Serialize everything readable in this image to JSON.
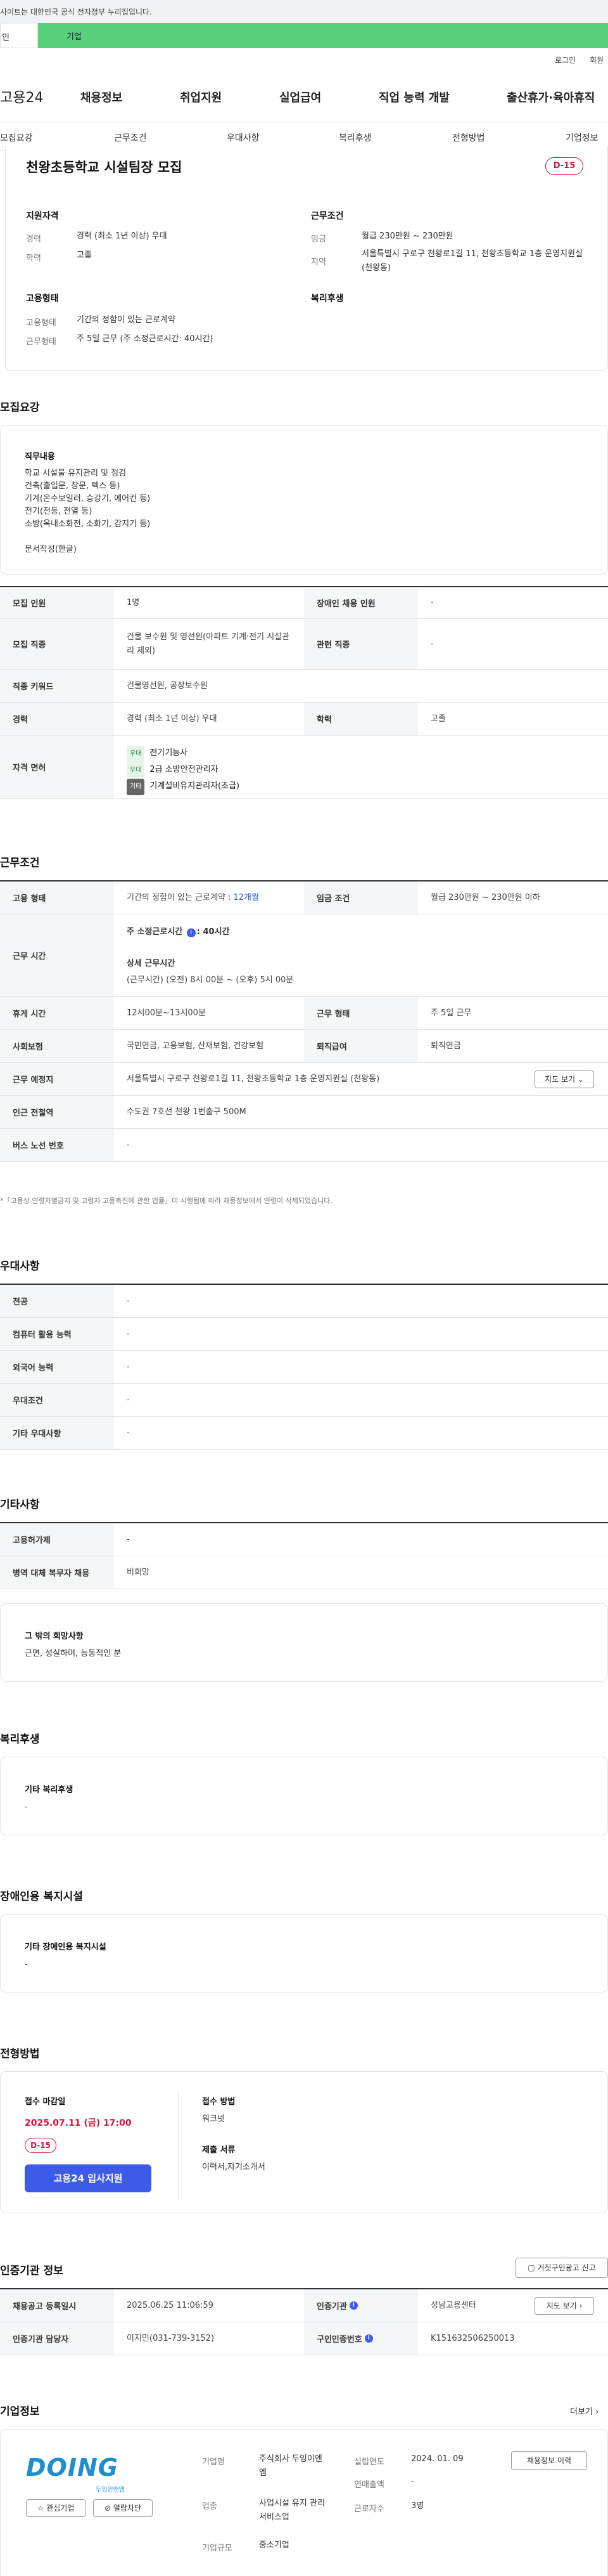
{
  "topbar": {
    "text": "사이트는 대한민국 공식 전자정부 누리집입니다."
  },
  "tabs": [
    "인",
    "기업"
  ],
  "util": {
    "login": "로그인",
    "join": "회원"
  },
  "header": {
    "logo": "고용24",
    "nav": [
      "채용정보",
      "취업지원",
      "실업급여",
      "직업 능력 개발",
      "출산휴가·육아휴직"
    ]
  },
  "subnav": [
    "모집요강",
    "근무조건",
    "우대사항",
    "복리후생",
    "전형방법",
    "기업정보"
  ],
  "summary": {
    "title": "천왕초등학교 시설팀장 모집",
    "dday": "D-15",
    "qual_head": "지원자격",
    "cond_head": "근무조건",
    "career_label": "경력",
    "career": "경력 (최소 1년 이상) 우대",
    "edu_label": "학력",
    "edu": "고졸",
    "wage_label": "임금",
    "wage": "월급 230만원 ~ 230만원",
    "region_label": "지역",
    "region": "서울특별시 구로구 천왕로1길 11, 천왕초등학교 1층 운영지원실 (천왕동)",
    "emp_head": "고용형태",
    "welfare_head": "복리후생",
    "emp_label": "고용형태",
    "emp": "기간의 정함이 있는 근로계약",
    "work_label": "근무형태",
    "work": "주 5일 근무 (주 소정근로시간: 40시간)"
  },
  "recruit": {
    "heading": "모집요강",
    "duty_title": "직무내용",
    "duty": [
      "학교 시설물 유지관리 및 점검",
      "건축(출입문, 창문, 텍스 등)",
      "기계(온수보일러, 승강기, 에어컨 등)",
      "전기(전등, 전열 등)",
      "소방(옥내소화전, 소화기, 감지기 등)",
      "",
      "문서작성(한글)"
    ],
    "rows": [
      {
        "l1": "모집 인원",
        "v1": "1명",
        "l2": "장애인 채용 인원",
        "v2": "-"
      },
      {
        "l1": "모집 직종",
        "v1": "건물 보수원 및 영선원(아파트 기계·전기 시설관리 제외)",
        "l2": "관련 직종",
        "v2": "-"
      },
      {
        "l1": "직종 키워드",
        "v1": "건물영선원, 공장보수원"
      },
      {
        "l1": "경력",
        "v1": "경력 (최소 1년 이상) 우대",
        "l2": "학력",
        "v2": "고졸"
      }
    ],
    "license_label": "자격 면허",
    "licenses": [
      {
        "badge": "우대",
        "name": "전기기능사"
      },
      {
        "badge": "우대",
        "name": "2급 소방안전관리자"
      },
      {
        "badge": "기타",
        "name": "기계설비유지관리자(초급)"
      }
    ],
    "colors": {
      "pref_bg": "#e6f4ea",
      "pref_fg": "#2d8a49",
      "etc_bg": "#666666",
      "etc_fg": "#ffffff"
    }
  },
  "conditions": {
    "heading": "근무조건",
    "emp_label": "고용 형태",
    "emp": "기간의 정함이 있는 근로계약 : ",
    "emp_period": "12개월",
    "wage_label": "임금 조건",
    "wage": "월급 230만원 ~ 230만원 이하",
    "hours_label": "근무 시간",
    "hours_week": "주 소정근로시간 ",
    "hours_week_val": ": 40시간",
    "hours_detail_title": "상세 근무시간",
    "hours_detail": "(근무시간) (오전) 8시 00분 ~ (오후) 5시 00분",
    "rest_label": "휴게 시간",
    "rest": "12시00분~13시00분",
    "form_label": "근무 형태",
    "form": "주 5일 근무",
    "ins_label": "사회보험",
    "ins": "국민연금, 고용보험, 산재보험, 건강보험",
    "retire_label": "퇴직급여",
    "retire": "퇴직연금",
    "loc_label": "근무 예정지",
    "loc": "서울특별시 구로구 천왕로1길 11, 천왕초등학교 1층 운영지원실 (천왕동)",
    "map_btn": "지도 보기",
    "sub_label": "인근 전철역",
    "sub": "수도권 7호선 천왕 1번출구 500M",
    "bus_label": "버스 노선 번호",
    "bus": "-",
    "note": "*「고용상 연령차별금지 및 고령자 고용촉진에 관한 법률」이 시행됨에 따라 채용정보에서 연령이 삭제되었습니다."
  },
  "preferred": {
    "heading": "우대사항",
    "rows": [
      {
        "l": "전공",
        "v": "-"
      },
      {
        "l": "컴퓨터 활용 능력",
        "v": "-"
      },
      {
        "l": "외국어 능력",
        "v": "-"
      },
      {
        "l": "우대조건",
        "v": "-"
      },
      {
        "l": "기타 우대사항",
        "v": "-"
      }
    ]
  },
  "others": {
    "heading": "기타사항",
    "rows": [
      {
        "l": "고용허가제",
        "v": "-"
      },
      {
        "l": "병역 대체 복무자 채용",
        "v": "비희망"
      }
    ],
    "hope_title": "그 밖의 희망사항",
    "hope": "근면, 성실하며, 능동적인 분"
  },
  "welfare": {
    "heading": "복리후생",
    "box_title": "기타 복리후생",
    "box_value": "-"
  },
  "disability": {
    "heading": "장애인용 복지시설",
    "box_title": "기타 장애인용 복지시설",
    "box_value": "-"
  },
  "selection": {
    "heading": "전형방법",
    "deadline_label": "접수 마감일",
    "deadline": "2025.07.11 (금) 17:00",
    "dday": "D-15",
    "apply_btn": "고용24 입사지원",
    "method_label": "접수 방법",
    "method": "워크넷",
    "docs_label": "제출 서류",
    "docs": "이력서,자기소개서"
  },
  "cert": {
    "heading": "인증기관 정보",
    "report_btn": "거짓구인광고 신고",
    "reg_label": "채용공고 등록일시",
    "reg": "2025.06.25 11:06:59",
    "org_label": "인증기관",
    "org": "성남고용센터",
    "map_btn": "지도 보기",
    "mgr_label": "인증기관 담당자",
    "mgr": "이지민(031-739-3152)",
    "id_label": "구인인증번호",
    "id": "K151632506250013"
  },
  "company": {
    "heading": "기업정보",
    "more": "더보기",
    "logo_text": "DOING",
    "logo_sub": "두잉인앤엠",
    "btn_interest": "관심기업",
    "btn_block": "열람차단",
    "name_label": "기업명",
    "name": "주식회사 두잉이엔엠",
    "estab_label": "설립연도",
    "estab": "2024. 01. 09",
    "hire_btn": "채용정보 이력",
    "biz_label": "업종",
    "biz": "사업시설 유지 관리 서비스업",
    "sales_label": "연매출액",
    "sales": "-",
    "emp_label": "근로자수",
    "emp": "3명",
    "size_label": "기업규모",
    "size": "중소기업"
  }
}
